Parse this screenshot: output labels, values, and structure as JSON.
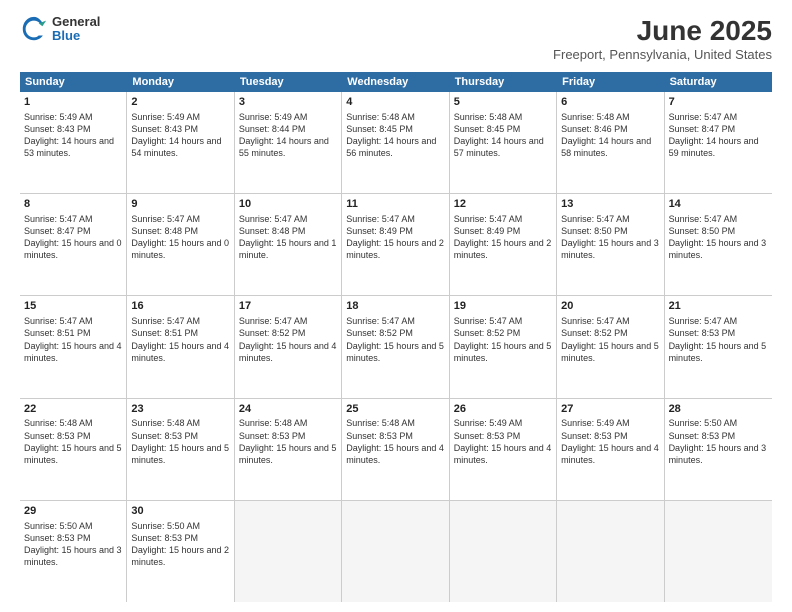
{
  "header": {
    "logo_general": "General",
    "logo_blue": "Blue",
    "title": "June 2025",
    "subtitle": "Freeport, Pennsylvania, United States"
  },
  "days": [
    "Sunday",
    "Monday",
    "Tuesday",
    "Wednesday",
    "Thursday",
    "Friday",
    "Saturday"
  ],
  "weeks": [
    [
      {
        "day": "1",
        "rise": "5:49 AM",
        "set": "8:43 PM",
        "daylight": "14 hours and 53 minutes."
      },
      {
        "day": "2",
        "rise": "5:49 AM",
        "set": "8:43 PM",
        "daylight": "14 hours and 54 minutes."
      },
      {
        "day": "3",
        "rise": "5:49 AM",
        "set": "8:44 PM",
        "daylight": "14 hours and 55 minutes."
      },
      {
        "day": "4",
        "rise": "5:48 AM",
        "set": "8:45 PM",
        "daylight": "14 hours and 56 minutes."
      },
      {
        "day": "5",
        "rise": "5:48 AM",
        "set": "8:45 PM",
        "daylight": "14 hours and 57 minutes."
      },
      {
        "day": "6",
        "rise": "5:48 AM",
        "set": "8:46 PM",
        "daylight": "14 hours and 58 minutes."
      },
      {
        "day": "7",
        "rise": "5:47 AM",
        "set": "8:47 PM",
        "daylight": "14 hours and 59 minutes."
      }
    ],
    [
      {
        "day": "8",
        "rise": "5:47 AM",
        "set": "8:47 PM",
        "daylight": "15 hours and 0 minutes."
      },
      {
        "day": "9",
        "rise": "5:47 AM",
        "set": "8:48 PM",
        "daylight": "15 hours and 0 minutes."
      },
      {
        "day": "10",
        "rise": "5:47 AM",
        "set": "8:48 PM",
        "daylight": "15 hours and 1 minute."
      },
      {
        "day": "11",
        "rise": "5:47 AM",
        "set": "8:49 PM",
        "daylight": "15 hours and 2 minutes."
      },
      {
        "day": "12",
        "rise": "5:47 AM",
        "set": "8:49 PM",
        "daylight": "15 hours and 2 minutes."
      },
      {
        "day": "13",
        "rise": "5:47 AM",
        "set": "8:50 PM",
        "daylight": "15 hours and 3 minutes."
      },
      {
        "day": "14",
        "rise": "5:47 AM",
        "set": "8:50 PM",
        "daylight": "15 hours and 3 minutes."
      }
    ],
    [
      {
        "day": "15",
        "rise": "5:47 AM",
        "set": "8:51 PM",
        "daylight": "15 hours and 4 minutes."
      },
      {
        "day": "16",
        "rise": "5:47 AM",
        "set": "8:51 PM",
        "daylight": "15 hours and 4 minutes."
      },
      {
        "day": "17",
        "rise": "5:47 AM",
        "set": "8:52 PM",
        "daylight": "15 hours and 4 minutes."
      },
      {
        "day": "18",
        "rise": "5:47 AM",
        "set": "8:52 PM",
        "daylight": "15 hours and 5 minutes."
      },
      {
        "day": "19",
        "rise": "5:47 AM",
        "set": "8:52 PM",
        "daylight": "15 hours and 5 minutes."
      },
      {
        "day": "20",
        "rise": "5:47 AM",
        "set": "8:52 PM",
        "daylight": "15 hours and 5 minutes."
      },
      {
        "day": "21",
        "rise": "5:47 AM",
        "set": "8:53 PM",
        "daylight": "15 hours and 5 minutes."
      }
    ],
    [
      {
        "day": "22",
        "rise": "5:48 AM",
        "set": "8:53 PM",
        "daylight": "15 hours and 5 minutes."
      },
      {
        "day": "23",
        "rise": "5:48 AM",
        "set": "8:53 PM",
        "daylight": "15 hours and 5 minutes."
      },
      {
        "day": "24",
        "rise": "5:48 AM",
        "set": "8:53 PM",
        "daylight": "15 hours and 5 minutes."
      },
      {
        "day": "25",
        "rise": "5:48 AM",
        "set": "8:53 PM",
        "daylight": "15 hours and 4 minutes."
      },
      {
        "day": "26",
        "rise": "5:49 AM",
        "set": "8:53 PM",
        "daylight": "15 hours and 4 minutes."
      },
      {
        "day": "27",
        "rise": "5:49 AM",
        "set": "8:53 PM",
        "daylight": "15 hours and 4 minutes."
      },
      {
        "day": "28",
        "rise": "5:50 AM",
        "set": "8:53 PM",
        "daylight": "15 hours and 3 minutes."
      }
    ],
    [
      {
        "day": "29",
        "rise": "5:50 AM",
        "set": "8:53 PM",
        "daylight": "15 hours and 3 minutes."
      },
      {
        "day": "30",
        "rise": "5:50 AM",
        "set": "8:53 PM",
        "daylight": "15 hours and 2 minutes."
      },
      null,
      null,
      null,
      null,
      null
    ]
  ]
}
